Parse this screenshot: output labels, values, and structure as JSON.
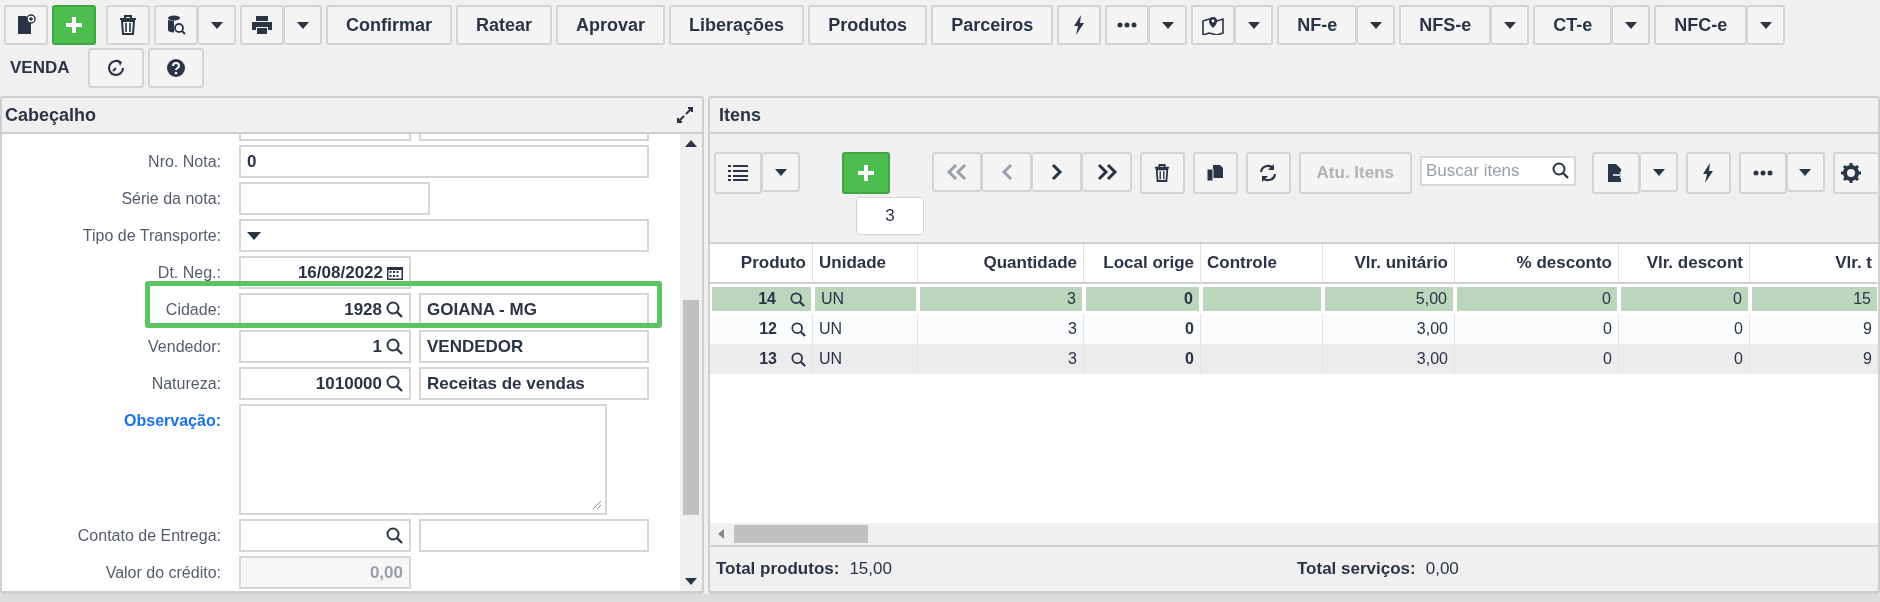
{
  "toolbar": {
    "buttons": [
      "Confirmar",
      "Ratear",
      "Aprovar",
      "Liberações",
      "Produtos",
      "Parceiros"
    ],
    "document_menus": [
      "NF-e",
      "NFS-e",
      "CT-e",
      "NFC-e"
    ],
    "mode": "VENDA"
  },
  "header_panel": {
    "title": "Cabeçalho",
    "fields": [
      {
        "kind": "text",
        "label": "Nro. Nota:",
        "value": "0",
        "highlighted": false,
        "accent": false
      },
      {
        "kind": "short",
        "label": "Série da nota:",
        "highlighted": false,
        "accent": false
      },
      {
        "kind": "select",
        "label": "Tipo de Transporte:",
        "highlighted": false,
        "accent": false
      },
      {
        "kind": "date",
        "label": "Dt. Neg.:",
        "value": "16/08/2022",
        "highlighted": false,
        "accent": false
      },
      {
        "kind": "lookup",
        "label": "Cidade:",
        "code": "1928",
        "name": "GOIANA - MG",
        "highlighted": true,
        "accent": false
      },
      {
        "kind": "lookup",
        "label": "Vendedor:",
        "code": "1",
        "name": "VENDEDOR",
        "highlighted": false,
        "accent": false
      },
      {
        "kind": "lookup",
        "label": "Natureza:",
        "code": "1010000",
        "name": "Receitas de vendas",
        "highlighted": false,
        "accent": false
      },
      {
        "kind": "textarea",
        "label": "Observação:",
        "highlighted": false,
        "accent": true
      },
      {
        "kind": "lookup",
        "label": "Contato de Entrega:",
        "highlighted": false,
        "accent": false
      },
      {
        "kind": "readonly",
        "label": "Valor do crédito:",
        "value": "0,00",
        "highlighted": false,
        "accent": false
      }
    ]
  },
  "items_panel": {
    "title": "Itens",
    "pager": [
      {
        "disabled": true
      },
      {
        "disabled": true
      },
      {
        "disabled": false
      },
      {
        "disabled": false
      }
    ],
    "update_button": {
      "label": "Atu. Itens",
      "disabled": true
    },
    "search": {
      "placeholder": "Buscar itens"
    },
    "tooltip": "3",
    "columns": [
      "Produto",
      "Unidade",
      "Quantidade",
      "Local orige",
      "Controle",
      "Vlr. unitário",
      "% desconto",
      "Vlr. descont",
      "Vlr. t"
    ],
    "rows": [
      {
        "selected": true,
        "produto": "14",
        "unidade": "UN",
        "quantidade": "3",
        "local_origem": "0",
        "vlr_unitario": "5,00",
        "pct_desconto": "0",
        "vlr_desconto": "0",
        "vlr_total": "15"
      },
      {
        "selected": false,
        "produto": "12",
        "unidade": "UN",
        "quantidade": "3",
        "local_origem": "0",
        "vlr_unitario": "3,00",
        "pct_desconto": "0",
        "vlr_desconto": "0",
        "vlr_total": "9"
      },
      {
        "selected": false,
        "produto": "13",
        "unidade": "UN",
        "quantidade": "3",
        "local_origem": "0",
        "vlr_unitario": "3,00",
        "pct_desconto": "0",
        "vlr_desconto": "0",
        "vlr_total": "9"
      }
    ],
    "totals": [
      {
        "label": "Total produtos:",
        "value": "15,00"
      },
      {
        "label": "Total serviços:",
        "value": "0,00"
      }
    ]
  }
}
